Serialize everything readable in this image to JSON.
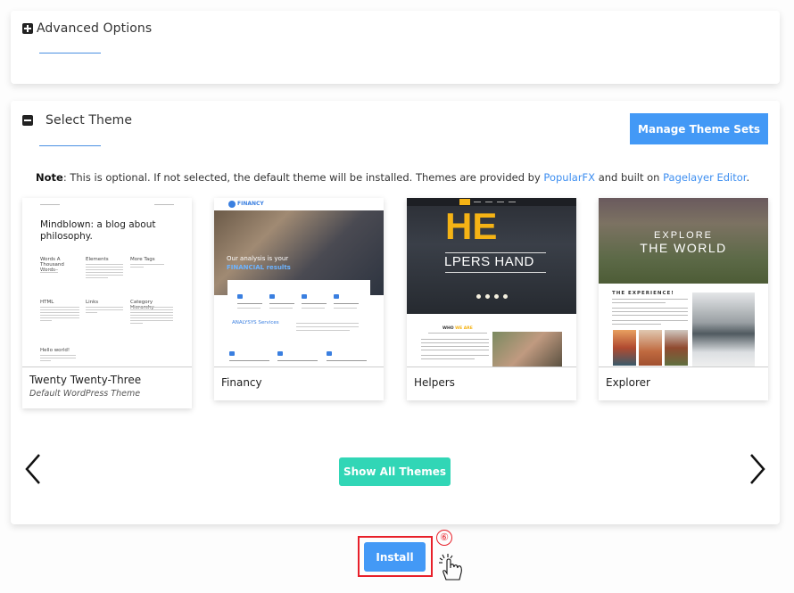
{
  "advanced_options": {
    "title": "Advanced Options",
    "toggle_icon": "plus-square-icon"
  },
  "select_theme": {
    "title": "Select Theme",
    "toggle_icon": "minus-square-icon",
    "manage_button": "Manage Theme Sets",
    "note": {
      "label": "Note",
      "text_before": ": This is optional. If not selected, the default theme will be installed. Themes are provided by ",
      "link1": "PopularFX",
      "text_middle": " and built on ",
      "link2": "Pagelayer Editor",
      "text_after": "."
    },
    "themes": [
      {
        "name": "Twenty Twenty-Three",
        "subtitle": "Default WordPress Theme",
        "preview": {
          "headline": "Mindblown: a blog about philosophy.",
          "sections": [
            "Words A Thousand Words",
            "Elements",
            "More Tags",
            "HTML",
            "Links",
            "Category Hierarchy",
            "Hello world!"
          ]
        }
      },
      {
        "name": "Financy",
        "preview": {
          "logo": "FINANCY",
          "hero_line1": "Our analysis is your",
          "hero_line2": "FINANCIAL results",
          "services": "ANALYSYS Services"
        }
      },
      {
        "name": "Helpers",
        "preview": {
          "hero_big": "HE",
          "hero_rest": "LPERS HAND",
          "who_prefix": "WHO",
          "who_highlight": "WE ARE"
        }
      },
      {
        "name": "Explorer",
        "preview": {
          "line1": "EXPLORE",
          "line2": "THE WORLD",
          "section": "THE EXPERIENCE!"
        }
      }
    ],
    "prev_icon": "chevron-left-icon",
    "next_icon": "chevron-right-icon",
    "show_all_button": "Show All Themes"
  },
  "install_button": "Install",
  "step_marker": "⑥",
  "colors": {
    "primary": "#4399f6",
    "teal": "#31d6b6",
    "highlight_red": "#e8202a",
    "link": "#3d8ef0"
  }
}
